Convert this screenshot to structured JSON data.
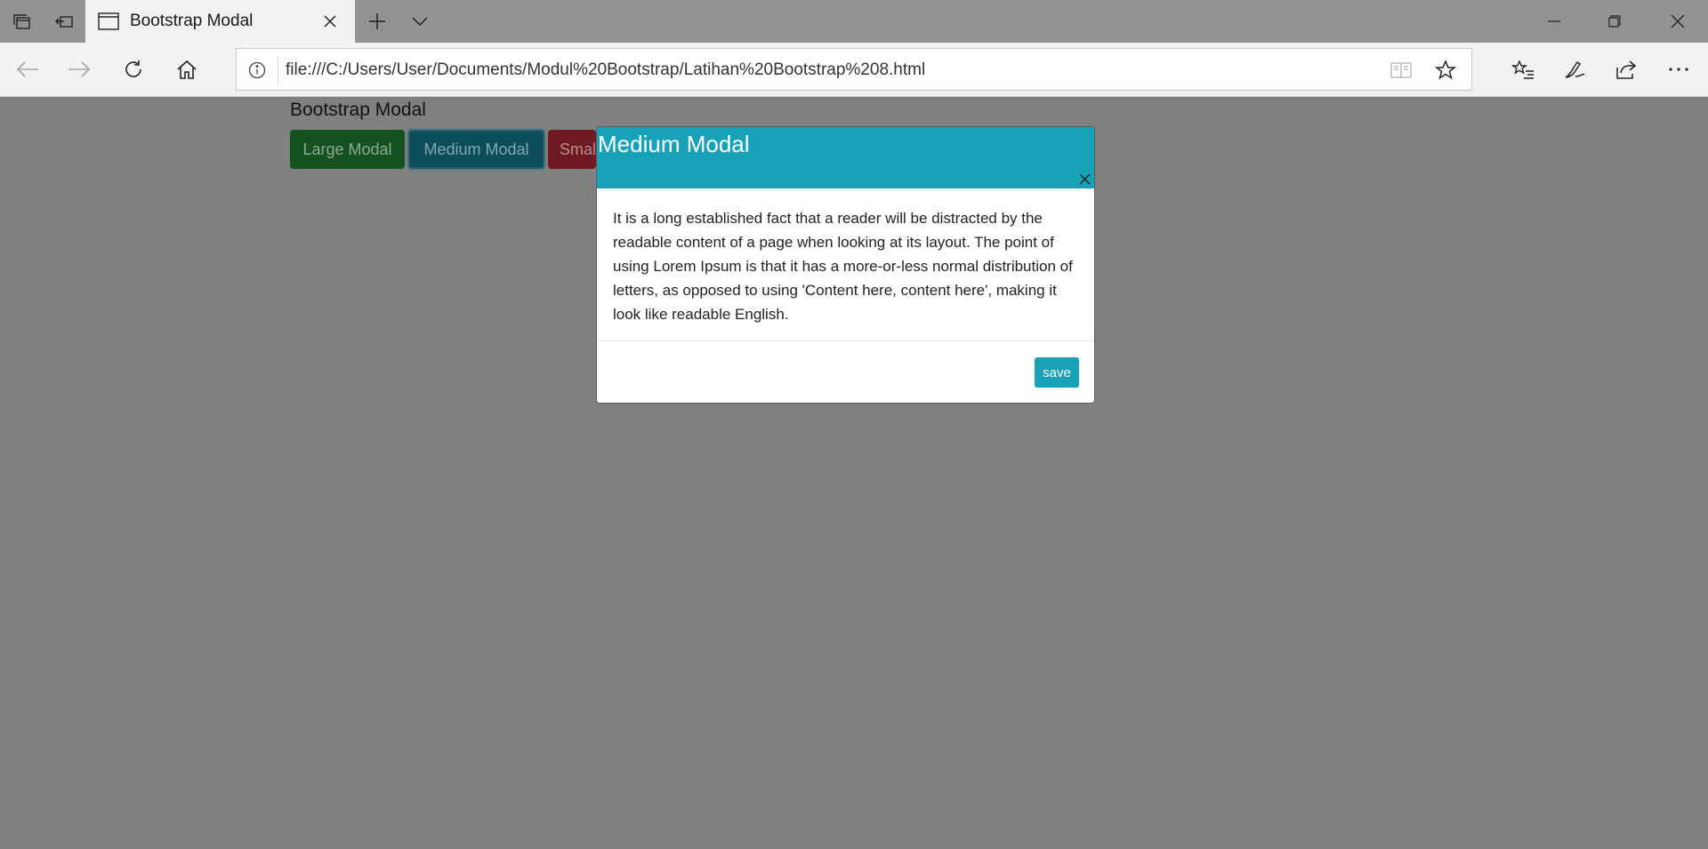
{
  "browser": {
    "tab_title": "Bootstrap Modal",
    "url": "file:///C:/Users/User/Documents/Modul%20Bootstrap/Latihan%20Bootstrap%208.html",
    "icons": {
      "tab_preview": "tab-preview-icon",
      "set_aside": "set-aside-tabs-icon",
      "new_tab": "plus-icon",
      "tab_list": "chevron-down-icon",
      "back": "back-arrow-icon",
      "forward": "forward-arrow-icon",
      "refresh": "refresh-icon",
      "home": "home-icon",
      "site_info": "info-icon",
      "reading_view": "reading-view-icon",
      "favorite": "star-icon",
      "favorites_hub": "favorites-list-icon",
      "notes": "pen-icon",
      "share": "share-icon",
      "more": "more-icon"
    }
  },
  "page": {
    "title": "Bootstrap Modal",
    "buttons": {
      "large": "Large Modal",
      "medium": "Medium Modal",
      "small": "Smal"
    }
  },
  "modal": {
    "title": "Medium Modal",
    "close_glyph": "×",
    "body": "It is a long established fact that a reader will be distracted by the readable content of a page when looking at its layout. The point of using Lorem Ipsum is that it has a more-or-less normal distribution of letters, as opposed to using 'Content here, content here', making it look like readable English.",
    "save_label": "save"
  },
  "colors": {
    "overlay": "#808080",
    "modal_header": "#17a2b8",
    "btn_success": "#28a745",
    "btn_info": "#17a2b8",
    "btn_danger": "#dc3545"
  }
}
